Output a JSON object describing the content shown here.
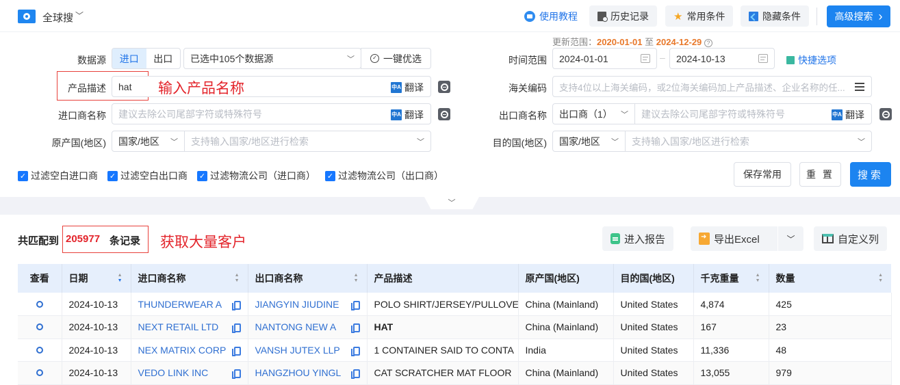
{
  "topbar": {
    "app_title": "全球搜",
    "tutorial": "使用教程",
    "history": "历史记录",
    "common": "常用条件",
    "hide": "隐藏条件",
    "advanced": "高级搜索",
    "advanced_arrow": "›"
  },
  "form": {
    "data_source_label": "数据源",
    "import_tab": "进口",
    "export_tab": "出口",
    "sources_selected": "已选中105个数据源",
    "one_click": "一键优选",
    "product_label": "产品描述",
    "product_value": "hat",
    "translate": "翻译",
    "importer_label": "进口商名称",
    "importer_placeholder": "建议去除公司尾部字符或特殊符号",
    "origin_label": "原产国(地区)",
    "origin_select": "国家/地区",
    "origin_placeholder": "支持输入国家/地区进行检索",
    "update_range_prefix": "更新范围：",
    "update_from": "2020-01-01",
    "update_to_word": "至",
    "update_to": "2024-12-29",
    "time_label": "时间范围",
    "date_from": "2024-01-01",
    "date_to": "2024-10-13",
    "date_sep": "–",
    "quick_options": "快捷选项",
    "hs_label": "海关编码",
    "hs_placeholder": "支持4位以上海关编码，或2位海关编码加上产品描述、企业名称的任...",
    "exporter_label": "出口商名称",
    "exporter_select": "出口商（1）",
    "exporter_placeholder": "建议去除公司尾部字符或特殊符号",
    "dest_label": "目的国(地区)",
    "dest_select": "国家/地区",
    "dest_placeholder": "支持输入国家/地区进行检索",
    "filters": [
      {
        "label": "过滤空白进口商",
        "checked": true
      },
      {
        "label": "过滤空白出口商",
        "checked": true
      },
      {
        "label": "过滤物流公司（进口商）",
        "checked": true
      },
      {
        "label": "过滤物流公司（出口商）",
        "checked": true
      }
    ],
    "save_common": "保存常用",
    "reset": "重 置",
    "search": "搜索"
  },
  "annotations": {
    "product_hint": "输入产品名称",
    "customers_hint": "获取大量客户"
  },
  "results": {
    "prefix": "共匹配到",
    "count": "205977",
    "suffix": "条记录",
    "report_btn": "进入报告",
    "export_btn": "导出Excel",
    "custom_cols_btn": "自定义列"
  },
  "table": {
    "columns": [
      "查看",
      "日期",
      "进口商名称",
      "出口商名称",
      "产品描述",
      "原产国(地区)",
      "目的国(地区)",
      "千克重量",
      "数量"
    ],
    "rows": [
      {
        "date": "2024-10-13",
        "importer": "THUNDERWEAR A",
        "exporter": "JIANGYIN JIUDINE",
        "product": "POLO SHIRT/JERSEY/PULLOVE",
        "origin": "China (Mainland)",
        "dest": "United States",
        "kg": "4,874",
        "qty": "425",
        "highlight": false
      },
      {
        "date": "2024-10-13",
        "importer": "NEXT RETAIL LTD",
        "exporter": "NANTONG NEW A",
        "product": "HAT",
        "origin": "China (Mainland)",
        "dest": "United States",
        "kg": "167",
        "qty": "23",
        "highlight": true
      },
      {
        "date": "2024-10-13",
        "importer": "NEX MATRIX CORP",
        "exporter": "VANSH JUTEX LLP",
        "product": "1 CONTAINER SAID TO CONTA",
        "origin": "India",
        "dest": "United States",
        "kg": "11,336",
        "qty": "48",
        "highlight": false
      },
      {
        "date": "2024-10-13",
        "importer": "VEDO LINK INC",
        "exporter": "HANGZHOU YINGL",
        "product": "CAT SCRATCHER MAT FLOOR",
        "origin": "China (Mainland)",
        "dest": "United States",
        "kg": "13,055",
        "qty": "979",
        "highlight": false
      }
    ]
  }
}
